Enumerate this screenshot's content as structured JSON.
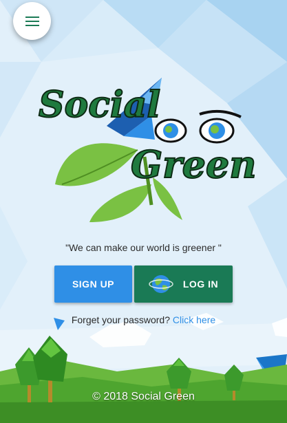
{
  "menu": {
    "icon": "hamburger-menu-icon"
  },
  "logo": {
    "line1": "Social",
    "line2": "Green"
  },
  "tagline": "\"We can make our world is greener \"",
  "signup_button": {
    "label": "SIGN UP"
  },
  "login_button": {
    "label": "LOG IN",
    "icon": "globe-icon"
  },
  "forgot": {
    "text": "Forget your password?",
    "link": "Click here"
  },
  "footer": "© 2018 Social Green",
  "colors": {
    "signup": "#2f8fe6",
    "login": "#1a7a55",
    "link": "#2f8fe6",
    "menu_icon": "#1a7a55"
  }
}
